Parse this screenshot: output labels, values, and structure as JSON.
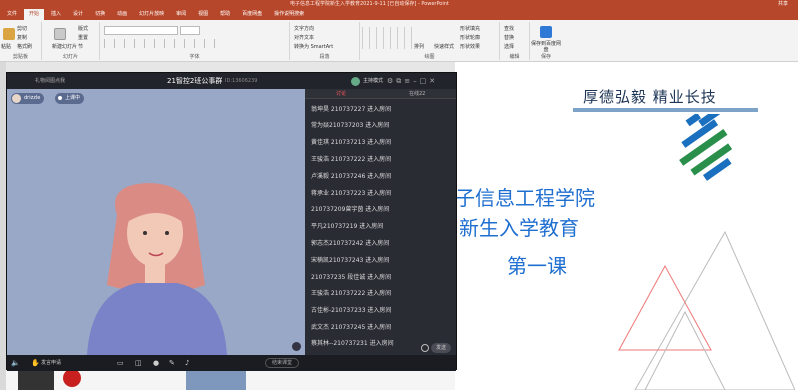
{
  "ppt": {
    "doc_title": "电子信息工程学院新生入学教育2021-9-11 [已自动保存] - PowerPoint",
    "sign_in": "共享",
    "tabs": [
      "文件",
      "开始",
      "插入",
      "设计",
      "切换",
      "动画",
      "幻灯片放映",
      "审阅",
      "视图",
      "帮助",
      "百度网盘",
      "操作说明搜索"
    ],
    "ribbon": {
      "clipboard": {
        "paste": "粘贴",
        "cut": "剪切",
        "copy": "复制",
        "format": "格式刷",
        "label": "剪贴板"
      },
      "slides": {
        "new": "新建幻灯片",
        "layout": "版式",
        "reset": "重置",
        "section": "节",
        "label": "幻灯片"
      },
      "font": {
        "label": "字体"
      },
      "paragraph": {
        "direction": "文字方向",
        "align": "对齐文本",
        "smartart": "转换为 SmartArt",
        "label": "段落"
      },
      "drawing": {
        "arrange": "排列",
        "quick_styles": "快速样式",
        "fill": "形状填充",
        "outline": "形状轮廓",
        "effects": "形状效果",
        "label": "绘图"
      },
      "editing": {
        "find": "查找",
        "replace": "替换",
        "select": "选择",
        "label": "编辑"
      },
      "save": {
        "save_to": "保存到百度网盘",
        "label": "保存"
      }
    }
  },
  "meeting": {
    "header_left": "礼物阅图点我",
    "title": "21智控2班公事群",
    "id_text": "ID:13606239",
    "mode": "主持模式",
    "user_tag": "drizzle",
    "on_mic": "上课中",
    "panel_tabs": [
      "讨论",
      "在线22"
    ],
    "messages": [
      "翁坤昊 210737227 进入房间",
      "常为燚210737203 进入房间",
      "黄佳琪 210737213 进入房间",
      "王骏浩 210737222 进入房间",
      "卢溪毅 210737246 进入房间",
      "蒋承业 210737223 进入房间",
      "210737209曾宇茵 进入房间",
      "平凡210737219 进入房间",
      "郭志杰210737242 进入房间",
      "宋楠凯210737243 进入房间",
      "210737235 段佳诚 进入房间",
      "王骏浩 210737222 进入房间",
      "古佳彬-210737233 进入房间",
      "武文杰 210737245 进入房间",
      "蔡其林--210737231 进入房间"
    ],
    "send": "发送",
    "apply_speak": "发言申请",
    "end_class": "结束课堂"
  },
  "slide": {
    "motto": "厚德弘毅 精业长技",
    "line1": "子信息工程学院",
    "line2": "新生入学教育",
    "line3": "第一课"
  }
}
